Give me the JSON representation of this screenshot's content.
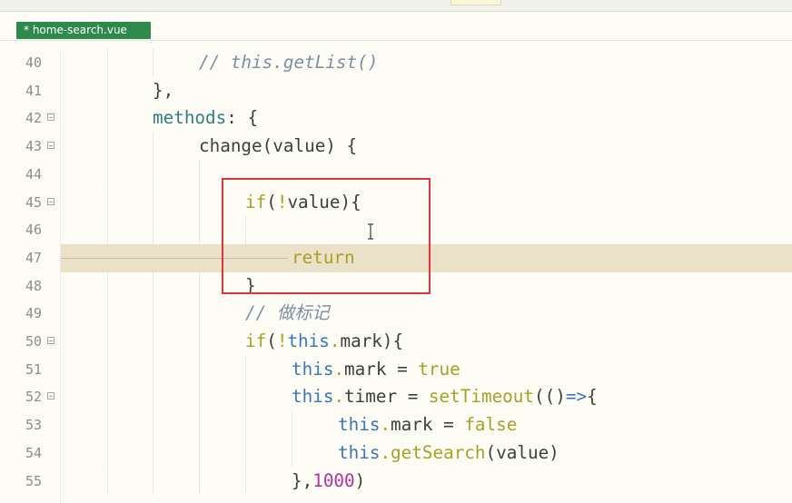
{
  "tab": {
    "label": "* home-search.vue"
  },
  "lines": [
    {
      "n": "40",
      "fold": false,
      "tokens": [
        {
          "t": "// this.getList()",
          "c": "cm"
        }
      ],
      "indent": 3
    },
    {
      "n": "41",
      "fold": false,
      "tokens": [
        {
          "t": "},",
          "c": "op"
        }
      ],
      "indent": 2
    },
    {
      "n": "42",
      "fold": true,
      "tokens": [
        {
          "t": "methods",
          "c": "prop"
        },
        {
          "t": ": {",
          "c": "op"
        }
      ],
      "indent": 2
    },
    {
      "n": "43",
      "fold": true,
      "tokens": [
        {
          "t": "change",
          "c": "op"
        },
        {
          "t": "(value) {",
          "c": "op"
        }
      ],
      "indent": 3
    },
    {
      "n": "44",
      "fold": false,
      "tokens": [],
      "indent": 4
    },
    {
      "n": "45",
      "fold": true,
      "tokens": [
        {
          "t": "if",
          "c": "kw"
        },
        {
          "t": "(",
          "c": "op"
        },
        {
          "t": "!",
          "c": "kw"
        },
        {
          "t": "value){",
          "c": "op"
        }
      ],
      "indent": 4
    },
    {
      "n": "46",
      "fold": false,
      "tokens": [],
      "indent": 5
    },
    {
      "n": "47",
      "fold": false,
      "tokens": [
        {
          "t": "return",
          "c": "kw"
        }
      ],
      "indent": 5,
      "highlight": true
    },
    {
      "n": "48",
      "fold": false,
      "tokens": [
        {
          "t": "}",
          "c": "op"
        }
      ],
      "indent": 4
    },
    {
      "n": "49",
      "fold": false,
      "tokens": [
        {
          "t": "// 做标记",
          "c": "cm"
        }
      ],
      "indent": 4
    },
    {
      "n": "50",
      "fold": true,
      "tokens": [
        {
          "t": "if",
          "c": "kw"
        },
        {
          "t": "(",
          "c": "op"
        },
        {
          "t": "!",
          "c": "kw"
        },
        {
          "t": "this",
          "c": "th"
        },
        {
          "t": ".",
          "c": "kw"
        },
        {
          "t": "mark){",
          "c": "op"
        }
      ],
      "indent": 4
    },
    {
      "n": "51",
      "fold": false,
      "tokens": [
        {
          "t": "this",
          "c": "th"
        },
        {
          "t": ".",
          "c": "kw"
        },
        {
          "t": "mark = ",
          "c": "op"
        },
        {
          "t": "true",
          "c": "kw"
        }
      ],
      "indent": 5
    },
    {
      "n": "52",
      "fold": true,
      "tokens": [
        {
          "t": "this",
          "c": "th"
        },
        {
          "t": ".",
          "c": "kw"
        },
        {
          "t": "timer = ",
          "c": "op"
        },
        {
          "t": "setTimeout",
          "c": "fn"
        },
        {
          "t": "(()",
          "c": "op"
        },
        {
          "t": "=>",
          "c": "arrow"
        },
        {
          "t": "{",
          "c": "op"
        }
      ],
      "indent": 5
    },
    {
      "n": "53",
      "fold": false,
      "tokens": [
        {
          "t": "this",
          "c": "th"
        },
        {
          "t": ".",
          "c": "kw"
        },
        {
          "t": "mark = ",
          "c": "op"
        },
        {
          "t": "false",
          "c": "kw"
        }
      ],
      "indent": 6
    },
    {
      "n": "54",
      "fold": false,
      "tokens": [
        {
          "t": "this",
          "c": "th"
        },
        {
          "t": ".",
          "c": "kw"
        },
        {
          "t": "getSearch",
          "c": "fn"
        },
        {
          "t": "(value)",
          "c": "op"
        }
      ],
      "indent": 6
    },
    {
      "n": "55",
      "fold": false,
      "tokens": [
        {
          "t": "},",
          "c": "op"
        },
        {
          "t": "1000",
          "c": "num"
        },
        {
          "t": ")",
          "c": "op"
        }
      ],
      "indent": 5
    }
  ],
  "colors": {
    "accent_tab": "#2D8A4B",
    "highlight_box": "#E0353A",
    "current_line": "#EBE1C8"
  }
}
